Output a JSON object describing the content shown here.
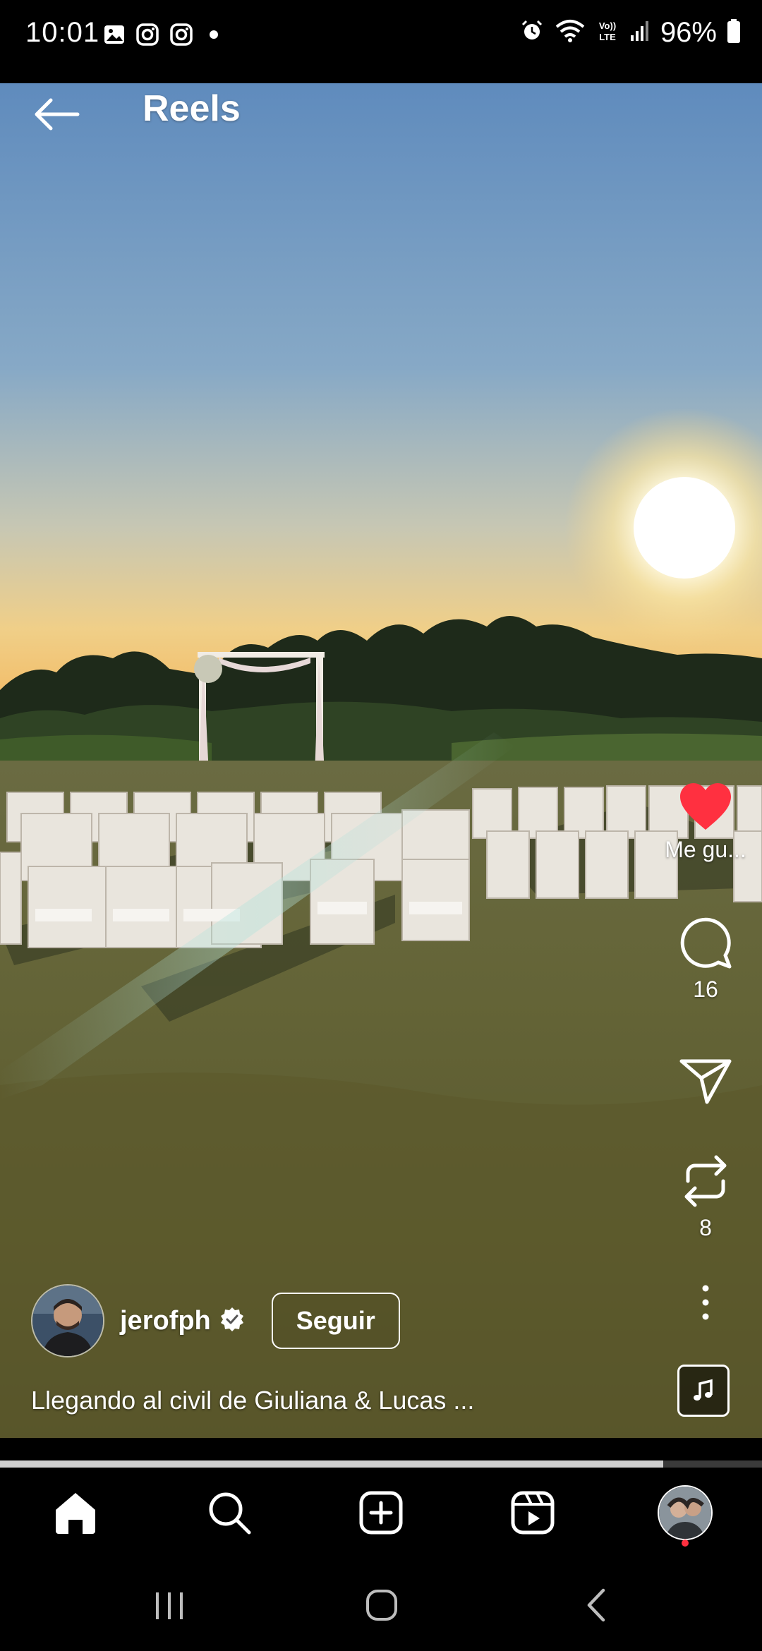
{
  "status_bar": {
    "time": "10:01",
    "battery": "96%",
    "left_icons": [
      "gallery-icon",
      "instagram-icon",
      "instagram-icon",
      "dot-icon"
    ],
    "right_icons": [
      "alarm-icon",
      "wifi-icon",
      "volte-icon",
      "signal-icon",
      "battery-icon"
    ],
    "volte_label": "Vo)) LTE"
  },
  "header": {
    "title": "Reels",
    "back_icon": "arrow-left-icon"
  },
  "actions": {
    "like_label": "Me gu...",
    "like_color": "#ff3040",
    "comments_count": "16",
    "reposts_count": "8"
  },
  "author": {
    "username": "jerofph",
    "verified": true,
    "follow_label": "Seguir"
  },
  "caption": "Llegando al civil de Giuliana & Lucas ...",
  "progress": {
    "fraction": 0.87
  },
  "bottom_nav": {
    "items": [
      "home-icon",
      "search-icon",
      "create-icon",
      "reels-icon",
      "profile-avatar"
    ],
    "notification_dot_color": "#ff3040"
  },
  "system_nav": {
    "items": [
      "recents-icon",
      "home-circle-icon",
      "back-chevron-icon"
    ]
  }
}
